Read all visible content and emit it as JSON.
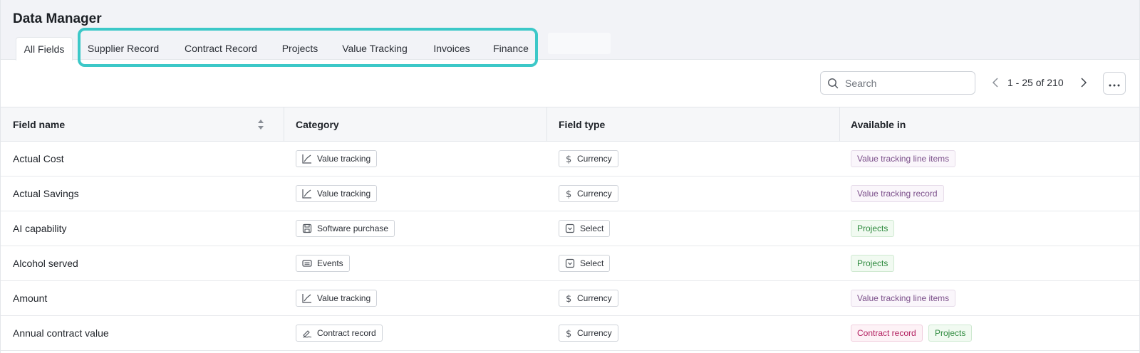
{
  "app": {
    "title": "Data Manager"
  },
  "tabs": [
    {
      "label": "All Fields",
      "active": true
    },
    {
      "label": "Supplier Record"
    },
    {
      "label": "Contract Record"
    },
    {
      "label": "Projects"
    },
    {
      "label": "Value Tracking"
    },
    {
      "label": "Invoices"
    },
    {
      "label": "Finance"
    }
  ],
  "search": {
    "placeholder": "Search",
    "value": ""
  },
  "pager": {
    "label": "1 - 25 of 210"
  },
  "columns": [
    "Field name",
    "Category",
    "Field type",
    "Available in"
  ],
  "rows": [
    {
      "name": "Actual Cost",
      "category": "Value tracking",
      "category_icon": "trend-line-icon",
      "type": "Currency",
      "type_icon": "dollar-icon",
      "available": [
        {
          "label": "Value tracking line items",
          "tone": "purple"
        }
      ]
    },
    {
      "name": "Actual Savings",
      "category": "Value tracking",
      "category_icon": "trend-line-icon",
      "type": "Currency",
      "type_icon": "dollar-icon",
      "available": [
        {
          "label": "Value tracking record",
          "tone": "purple"
        }
      ]
    },
    {
      "name": "AI capability",
      "category": "Software purchase",
      "category_icon": "floppy-disk-icon",
      "type": "Select",
      "type_icon": "select-box-icon",
      "available": [
        {
          "label": "Projects",
          "tone": "green"
        }
      ]
    },
    {
      "name": "Alcohol served",
      "category": "Events",
      "category_icon": "ticket-icon",
      "type": "Select",
      "type_icon": "select-box-icon",
      "available": [
        {
          "label": "Projects",
          "tone": "green"
        }
      ]
    },
    {
      "name": "Amount",
      "category": "Value tracking",
      "category_icon": "trend-line-icon",
      "type": "Currency",
      "type_icon": "dollar-icon",
      "available": [
        {
          "label": "Value tracking line items",
          "tone": "purple"
        }
      ]
    },
    {
      "name": "Annual contract value",
      "category": "Contract record",
      "category_icon": "signature-icon",
      "type": "Currency",
      "type_icon": "dollar-icon",
      "available": [
        {
          "label": "Contract record",
          "tone": "pink"
        },
        {
          "label": "Projects",
          "tone": "green"
        }
      ]
    }
  ],
  "colors": {
    "tab_highlight": "#3cc8c8",
    "header_bg": "#f2f3f7"
  }
}
